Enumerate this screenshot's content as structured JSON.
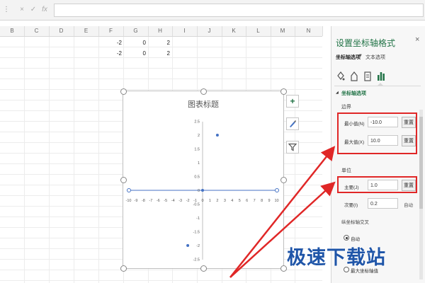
{
  "formula_bar": {
    "dots": "⋮",
    "cancel": "×",
    "enter": "✓",
    "fx": "fx",
    "value": ""
  },
  "columns": [
    "B",
    "C",
    "D",
    "E",
    "F",
    "G",
    "H",
    "I",
    "J",
    "K",
    "L",
    "M",
    "N"
  ],
  "cells": {
    "row1": [
      "-2",
      "0",
      "2"
    ],
    "row2": [
      "-2",
      "0",
      "2"
    ]
  },
  "chart": {
    "toolbar": {
      "add": "+",
      "style": "brush",
      "filter": "filter"
    }
  },
  "chart_data": {
    "type": "scatter",
    "title": "图表标题",
    "x": [
      -2,
      0,
      2
    ],
    "y": [
      -2,
      0,
      2
    ],
    "xlim": [
      -10,
      10
    ],
    "ylim": [
      -2.5,
      2.5
    ],
    "x_ticks": [
      "-10",
      "-9",
      "-8",
      "-7",
      "-6",
      "-5",
      "-4",
      "-3",
      "-2",
      "-1",
      "0",
      "1",
      "2",
      "3",
      "4",
      "5",
      "6",
      "7",
      "8",
      "9",
      "10"
    ],
    "y_ticks": [
      "2.5",
      "2",
      "1.5",
      "1",
      "0.5",
      "0",
      "-0.5",
      "-1",
      "-1.5",
      "-2",
      "-2.5"
    ],
    "grid": false,
    "point_color": "#4472c4"
  },
  "panel": {
    "title": "设置坐标轴格式",
    "close": "×",
    "tab_axis_options": "坐标轴选项",
    "tab_dropdown": "▼",
    "tab_text_options": "文本选项",
    "section_title": "坐标轴选项",
    "bounds_label": "边界",
    "min_label": "最小值(N)",
    "min_value": "-10.0",
    "max_label": "最大值(X)",
    "max_value": "10.0",
    "reset": "重置",
    "units_label": "单位",
    "major_label": "主要(J)",
    "major_value": "1.0",
    "minor_label": "次要(I)",
    "minor_value": "0.2",
    "minor_auto": "自动",
    "cross_label": "纵坐标轴交叉",
    "cross_auto": "自动",
    "cross_option_max": "最大坐标轴值",
    "accent": "#217346",
    "highlight": "#e02727"
  },
  "watermark": "极速下载站"
}
